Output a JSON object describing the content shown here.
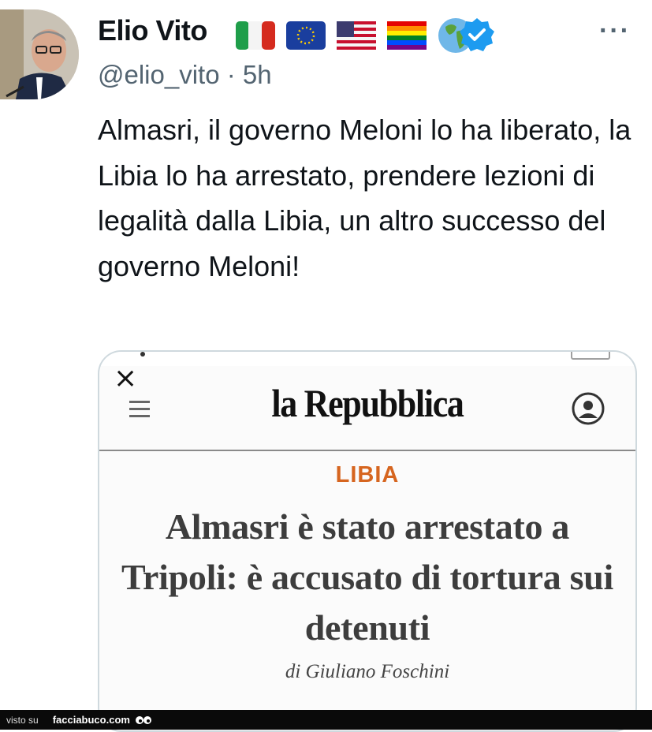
{
  "tweet": {
    "author_name": "Elio Vito",
    "handle_line": "@elio_vito · 5h",
    "text": "Almasri, il governo Meloni lo ha liberato, la Libia lo ha arrestato, prendere lezioni di legalità dalla Libia, un altro successo del governo Meloni!",
    "more_label": "···",
    "flags": [
      "italy-flag-icon",
      "eu-flag-icon",
      "usa-flag-icon",
      "rainbow-flag-icon",
      "globe-icon"
    ],
    "verified_icon": "verified-badge-icon"
  },
  "card": {
    "close_label": "×",
    "logo": "la Repubblica",
    "section": "LIBIA",
    "headline": "Almasri è stato arrestato a Tripoli: è accusato di tortura sui detenuti",
    "byline": "di Giuliano Foschini"
  },
  "footer": {
    "visto": "visto su",
    "site": "facciabuco.com"
  },
  "colors": {
    "section": "#d6651f",
    "verified": "#1d9bf0",
    "handle": "#536471"
  }
}
